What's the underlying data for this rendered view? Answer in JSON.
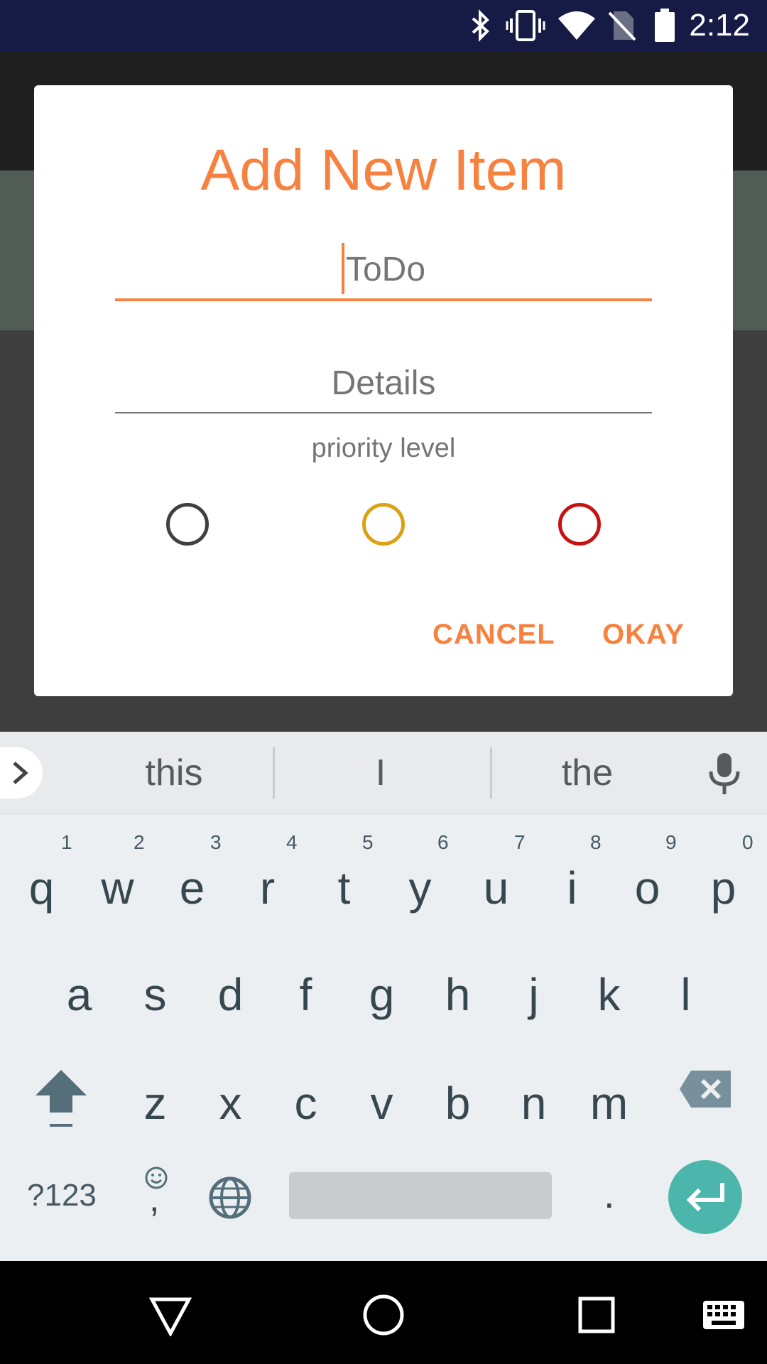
{
  "status_bar": {
    "time": "2:12",
    "icons": [
      "bluetooth-icon",
      "vibrate-icon",
      "wifi-icon",
      "no-sim-icon",
      "battery-icon"
    ]
  },
  "dialog": {
    "title": "Add New Item",
    "todo_field": {
      "value": "",
      "placeholder": "ToDo"
    },
    "details_field": {
      "value": "",
      "placeholder": "Details"
    },
    "priority_label": "priority level",
    "priority_options": [
      {
        "color": "#404040"
      },
      {
        "color": "#dca013"
      },
      {
        "color": "#c61212"
      }
    ],
    "cancel_label": "CANCEL",
    "okay_label": "OKAY",
    "accent_color": "#f7823f"
  },
  "keyboard": {
    "suggestions": [
      "this",
      "I",
      "the"
    ],
    "row1": [
      {
        "key": "q",
        "hint": "1"
      },
      {
        "key": "w",
        "hint": "2"
      },
      {
        "key": "e",
        "hint": "3"
      },
      {
        "key": "r",
        "hint": "4"
      },
      {
        "key": "t",
        "hint": "5"
      },
      {
        "key": "y",
        "hint": "6"
      },
      {
        "key": "u",
        "hint": "7"
      },
      {
        "key": "i",
        "hint": "8"
      },
      {
        "key": "o",
        "hint": "9"
      },
      {
        "key": "p",
        "hint": "0"
      }
    ],
    "row2": [
      "a",
      "s",
      "d",
      "f",
      "g",
      "h",
      "j",
      "k",
      "l"
    ],
    "row3": [
      "z",
      "x",
      "c",
      "v",
      "b",
      "n",
      "m"
    ],
    "symbols_label": "?123",
    "comma_label": ",",
    "period_label": ".",
    "enter_color": "#4db6ac"
  },
  "navbar": {
    "icons": [
      "back-icon",
      "home-icon",
      "recents-icon",
      "keyboard-switch-icon"
    ]
  }
}
